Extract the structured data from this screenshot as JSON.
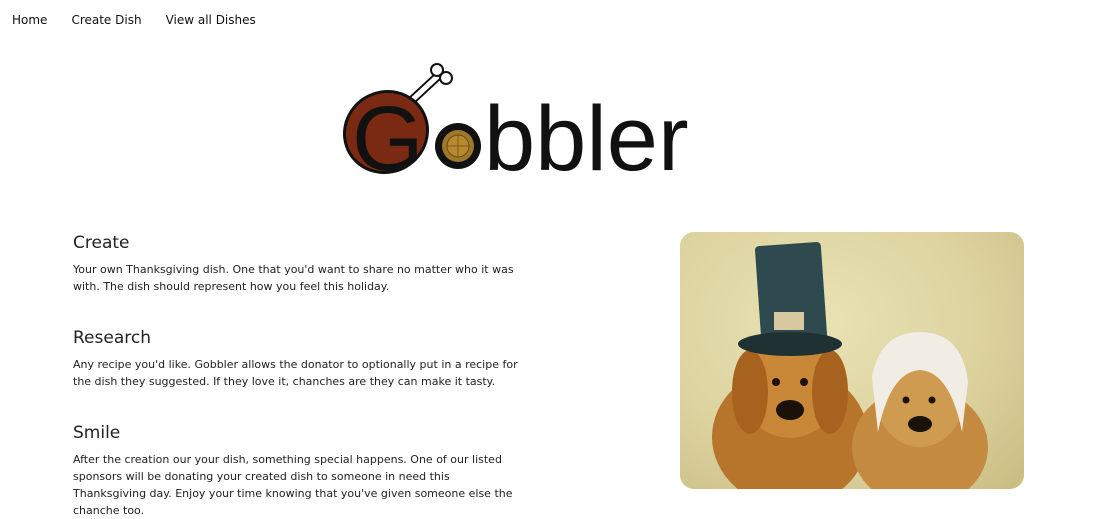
{
  "nav": {
    "items": [
      {
        "label": "Home"
      },
      {
        "label": "Create Dish"
      },
      {
        "label": "View all Dishes"
      }
    ]
  },
  "logo": {
    "text": "Gobbler",
    "colors": {
      "drumstick": "#7a2a12",
      "text": "#111111",
      "pie": "#a0782a"
    }
  },
  "features": [
    {
      "title": "Create",
      "text": "Your own Thanksgiving dish. One that you'd want to share no matter who it was with. The dish should represent how you feel this holiday."
    },
    {
      "title": "Research",
      "text": "Any recipe you'd like. Gobbler allows the donator to optionally put in a recipe for the dish they suggested. If they love it, chanches are they can make it tasty."
    },
    {
      "title": "Smile",
      "text": "After the creation our your dish, something special happens. One of our listed sponsors will be donating your created dish to someone in need this Thanksgiving day. Enjoy your time knowing that you've given someone else the chanche too."
    }
  ],
  "photo": {
    "subject": "two golden retrievers in pilgrim hats"
  }
}
